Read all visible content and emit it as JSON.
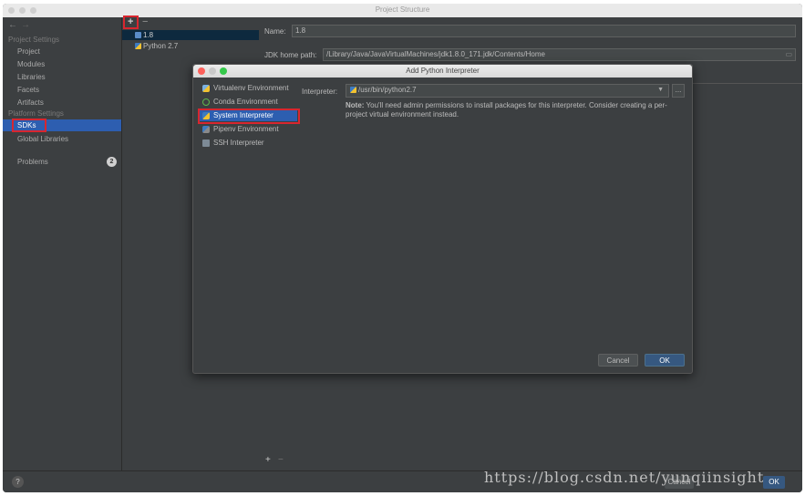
{
  "window": {
    "title": "Project Structure"
  },
  "sidebar": {
    "nav_back": "←",
    "nav_forward": "→",
    "project_settings_header": "Project Settings",
    "project_items": [
      "Project",
      "Modules",
      "Libraries",
      "Facets",
      "Artifacts"
    ],
    "platform_settings_header": "Platform Settings",
    "sdks": "SDKs",
    "global_libraries": "Global Libraries",
    "problems": "Problems",
    "problems_count": "2"
  },
  "tree": {
    "add_label": "+",
    "remove_label": "−",
    "items": [
      "1.8",
      "Python 2.7"
    ],
    "add_bottom": "+",
    "remove_bottom": "−"
  },
  "main": {
    "name_label": "Name:",
    "name_value": "1.8",
    "jdk_label": "JDK home path:",
    "jdk_value": "/Library/Java/JavaVirtualMachines/jdk1.8.0_171.jdk/Contents/Home"
  },
  "dialog": {
    "title": "Add Python Interpreter",
    "options": [
      "Virtualenv Environment",
      "Conda Environment",
      "System Interpreter",
      "Pipenv Environment",
      "SSH Interpreter"
    ],
    "selected_option": "System Interpreter",
    "interpreter_label": "Interpreter:",
    "interpreter_value": "/usr/bin/python2.7",
    "browse_label": "...",
    "note_bold": "Note:",
    "note_text": "You'll need admin permissions to install packages for this interpreter. Consider creating a per-project virtual environment instead.",
    "cancel_label": "Cancel",
    "ok_label": "OK"
  },
  "footer": {
    "help_label": "?",
    "cancel_label": "Cancel",
    "ok_label": "OK"
  },
  "watermark": "https://blog.csdn.net/yunqiinsight",
  "colors": {
    "selection": "#2d5eb0",
    "highlight_box": "#d8262f",
    "background": "#3c3f41"
  }
}
